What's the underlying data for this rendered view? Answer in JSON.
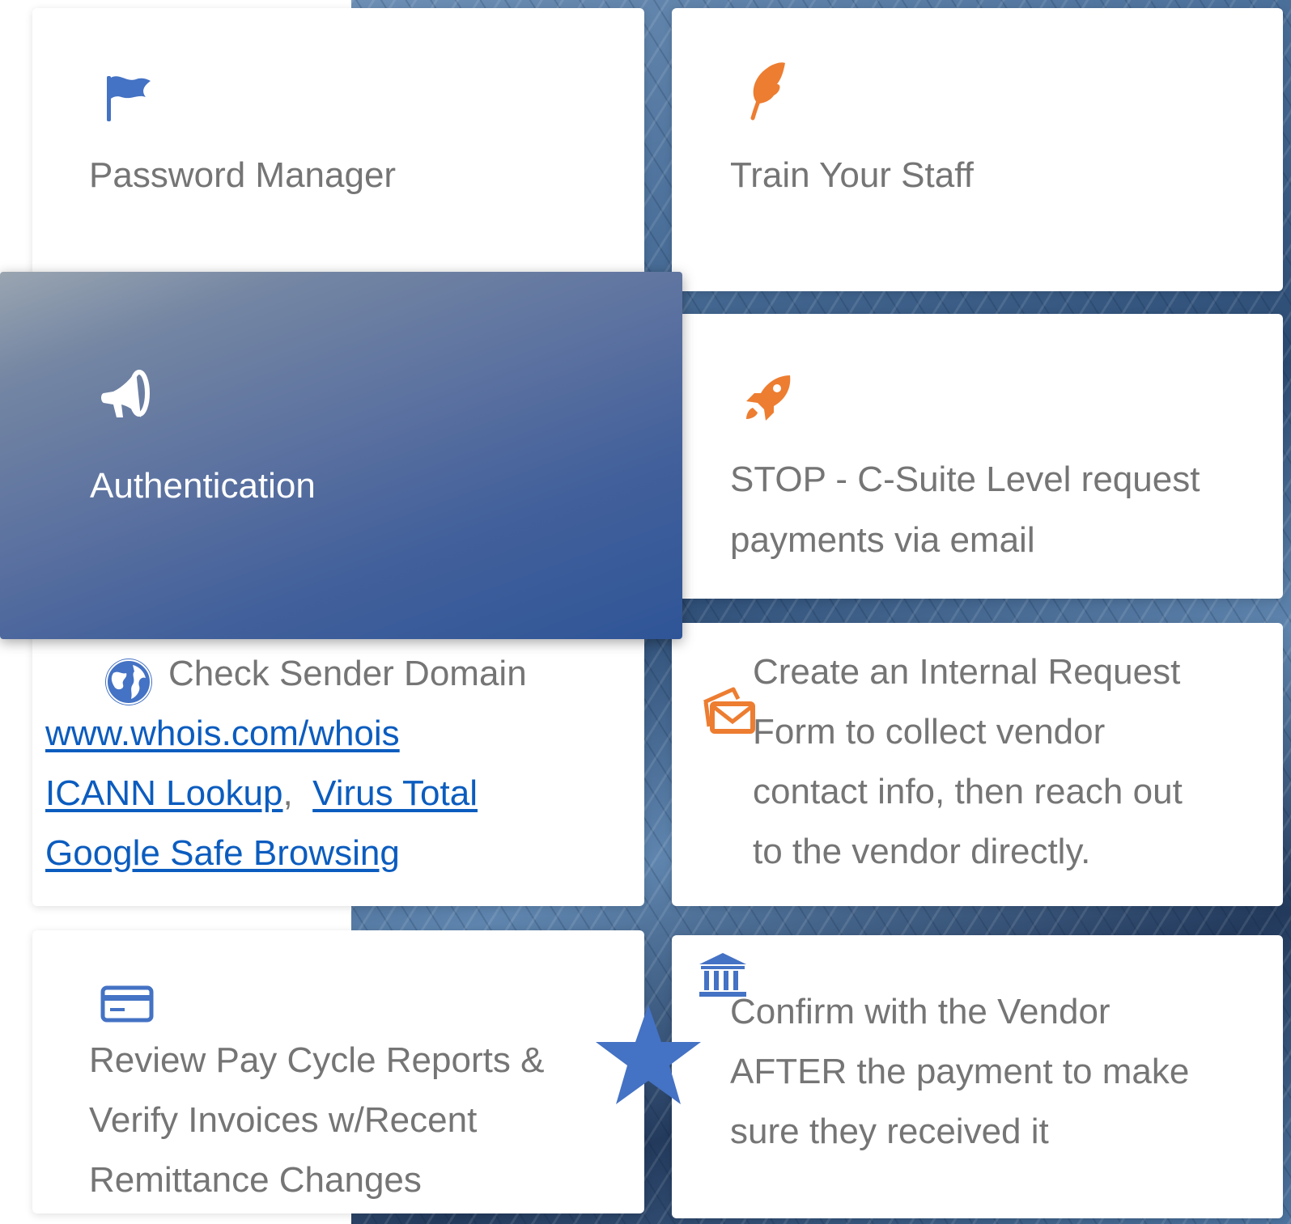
{
  "cards": {
    "password_manager": {
      "title": "Password Manager",
      "icon": "flag-icon",
      "icon_color": "#4472c4"
    },
    "train_staff": {
      "title": "Train Your Staff",
      "icon": "feather-icon",
      "icon_color": "#ed7d31"
    },
    "authentication": {
      "title": "Authentication",
      "icon": "megaphone-icon",
      "icon_color": "#ffffff"
    },
    "stop_csuite": {
      "line1": "STOP - C-Suite Level request",
      "line2": "payments via email",
      "icon": "rocket-icon",
      "icon_color": "#ed7d31"
    },
    "check_domain": {
      "title": "Check Sender Domain",
      "icon": "globe-icon",
      "icon_color": "#4472c4",
      "links": {
        "whois": "www.whois.com/whois",
        "icann": "ICANN Lookup",
        "separator": ",",
        "virustotal": "Virus Total",
        "google": "Google Safe Browsing"
      }
    },
    "internal_request": {
      "line1": "Create an Internal Request",
      "line2": "Form to collect vendor",
      "line3": "contact info, then reach out",
      "line4": "to the vendor directly.",
      "icon": "mail-envelope-icon",
      "icon_color": "#ed7d31"
    },
    "review_pay": {
      "line1": "Review Pay Cycle Reports &",
      "line2": "Verify Invoices w/Recent",
      "line3": "Remittance Changes",
      "icon": "credit-card-icon",
      "icon_color": "#4472c4"
    },
    "confirm_vendor": {
      "line1": "Confirm with the Vendor",
      "line2": "AFTER the payment to make",
      "line3": "sure they received it",
      "icon": "bank-icon",
      "icon_color": "#4472c4"
    }
  },
  "decorations": {
    "star": {
      "icon": "star-icon",
      "color": "#4472c4"
    },
    "background": "building-facade-photo"
  }
}
